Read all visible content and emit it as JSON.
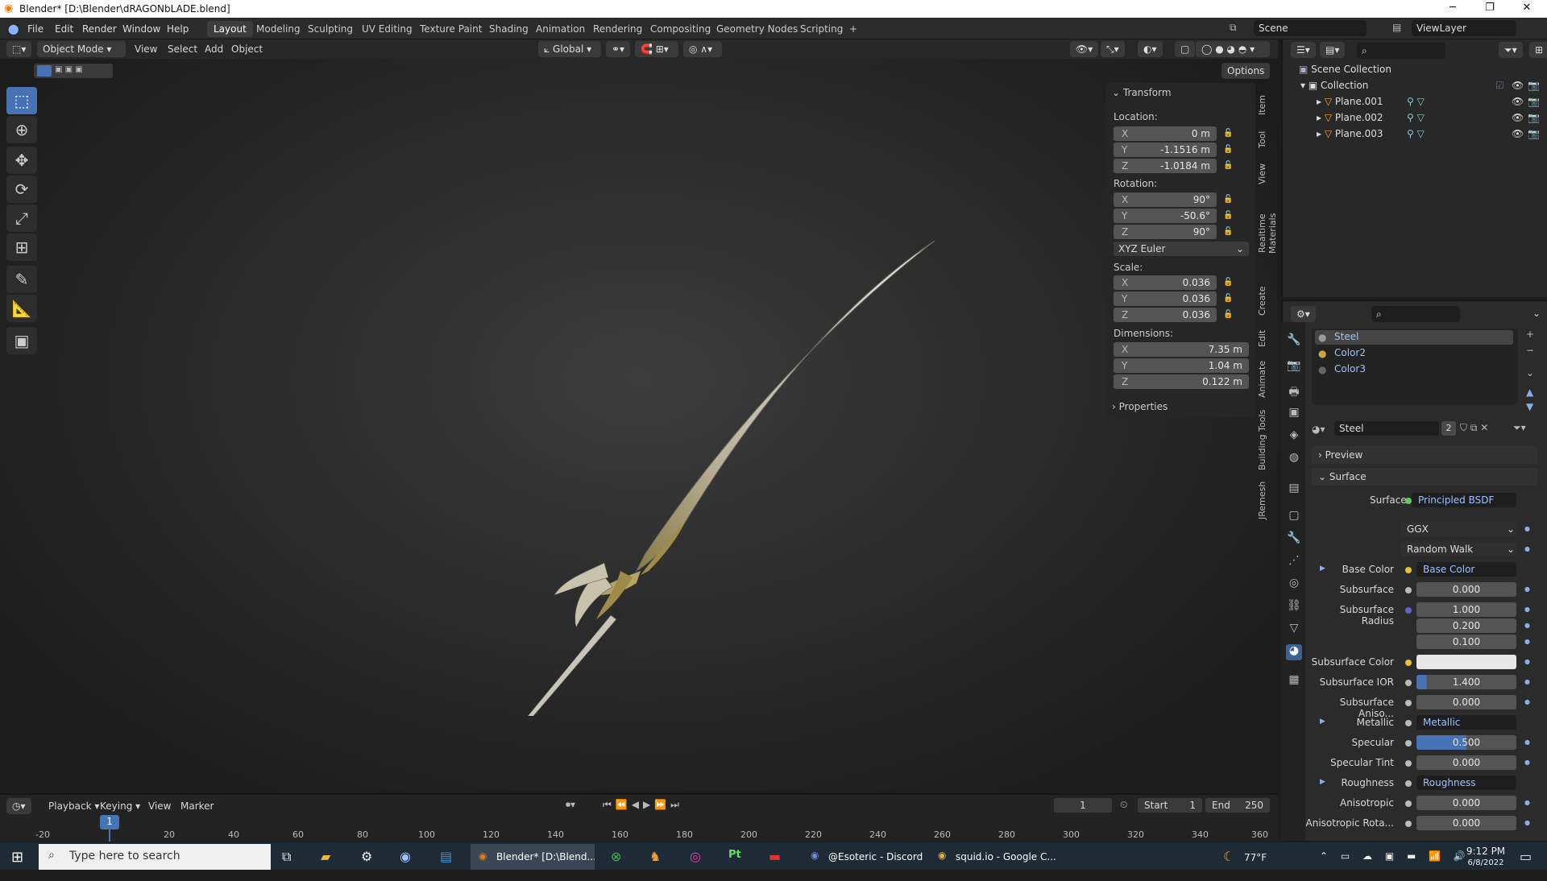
{
  "window": {
    "title": "Blender* [D:\\Blender\\dRAGONbLADE.blend]",
    "min": "─",
    "max": "❐",
    "close": "✕"
  },
  "menu": [
    "File",
    "Edit",
    "Render",
    "Window",
    "Help"
  ],
  "workspaces": [
    "Layout",
    "Modeling",
    "Sculpting",
    "UV Editing",
    "Texture Paint",
    "Shading",
    "Animation",
    "Rendering",
    "Compositing",
    "Geometry Nodes",
    "Scripting",
    "+"
  ],
  "scene": {
    "scene_name": "Scene",
    "view_layer": "ViewLayer"
  },
  "viewport": {
    "mode": "Object Mode",
    "menus": [
      "View",
      "Select",
      "Add",
      "Object"
    ],
    "orientation": "Global",
    "options": "Options"
  },
  "transform": {
    "header": "Transform",
    "location_label": "Location:",
    "location": [
      {
        "axis": "X",
        "value": "0 m"
      },
      {
        "axis": "Y",
        "value": "-1.1516 m"
      },
      {
        "axis": "Z",
        "value": "-1.0184 m"
      }
    ],
    "rotation_label": "Rotation:",
    "rotation": [
      {
        "axis": "X",
        "value": "90°"
      },
      {
        "axis": "Y",
        "value": "-50.6°"
      },
      {
        "axis": "Z",
        "value": "90°"
      }
    ],
    "rotation_mode": "XYZ Euler",
    "scale_label": "Scale:",
    "scale": [
      {
        "axis": "X",
        "value": "0.036"
      },
      {
        "axis": "Y",
        "value": "0.036"
      },
      {
        "axis": "Z",
        "value": "0.036"
      }
    ],
    "dimensions_label": "Dimensions:",
    "dimensions": [
      {
        "axis": "X",
        "value": "7.35 m"
      },
      {
        "axis": "Y",
        "value": "1.04 m"
      },
      {
        "axis": "Z",
        "value": "0.122 m"
      }
    ],
    "properties": "Properties"
  },
  "side_tabs": [
    "Item",
    "Tool",
    "View",
    "Realtime Materials",
    "Create",
    "Edit",
    "Animate",
    "Building Tools",
    "JRemesh"
  ],
  "outliner": {
    "root": "Scene Collection",
    "collection": "Collection",
    "objects": [
      "Plane.001",
      "Plane.002",
      "Plane.003"
    ]
  },
  "materials": {
    "slots": [
      "Steel",
      "Color2",
      "Color3"
    ],
    "active": "Steel",
    "users": "2",
    "preview": "Preview",
    "surface_header": "Surface",
    "surface_label": "Surface",
    "surface_value": "Principled BSDF",
    "distribution": "GGX",
    "subsurface_method": "Random Walk",
    "rows": [
      {
        "label": "Base Color",
        "value": "Base Color",
        "type": "link"
      },
      {
        "label": "Subsurface",
        "value": "0.000",
        "type": "num"
      },
      {
        "label": "Subsurface Radius",
        "value": "1.000",
        "type": "num"
      },
      {
        "label": "",
        "value": "0.200",
        "type": "num"
      },
      {
        "label": "",
        "value": "0.100",
        "type": "num"
      },
      {
        "label": "Subsurface Color",
        "value": "",
        "type": "color"
      },
      {
        "label": "Subsurface IOR",
        "value": "1.400",
        "type": "num"
      },
      {
        "label": "Subsurface Aniso...",
        "value": "0.000",
        "type": "num"
      },
      {
        "label": "Metallic",
        "value": "Metallic",
        "type": "link"
      },
      {
        "label": "Specular",
        "value": "0.500",
        "type": "num"
      },
      {
        "label": "Specular Tint",
        "value": "0.000",
        "type": "num"
      },
      {
        "label": "Roughness",
        "value": "Roughness",
        "type": "link"
      },
      {
        "label": "Anisotropic",
        "value": "0.000",
        "type": "num"
      },
      {
        "label": "Anisotropic Rota...",
        "value": "0.000",
        "type": "num"
      }
    ]
  },
  "timeline": {
    "menus": [
      "Playback",
      "Keying",
      "View",
      "Marker"
    ],
    "current_frame": "1",
    "start_label": "Start",
    "start": "1",
    "end_label": "End",
    "end": "250",
    "ticks": [
      "-20",
      "20",
      "40",
      "60",
      "80",
      "100",
      "120",
      "140",
      "160",
      "180",
      "200",
      "220",
      "240",
      "260",
      "280",
      "300",
      "320",
      "340",
      "360"
    ],
    "cursor": "1"
  },
  "taskbar": {
    "search": "Type here to search",
    "apps": [
      "Blender* [D:\\Blend...",
      "@Esoteric - Discord",
      "squid.io - Google C..."
    ],
    "weather": "77°F",
    "time": "9:12 PM",
    "date": "6/8/2022"
  },
  "colors": {
    "accent": "#4772b3",
    "background": "#1d1d1d"
  }
}
